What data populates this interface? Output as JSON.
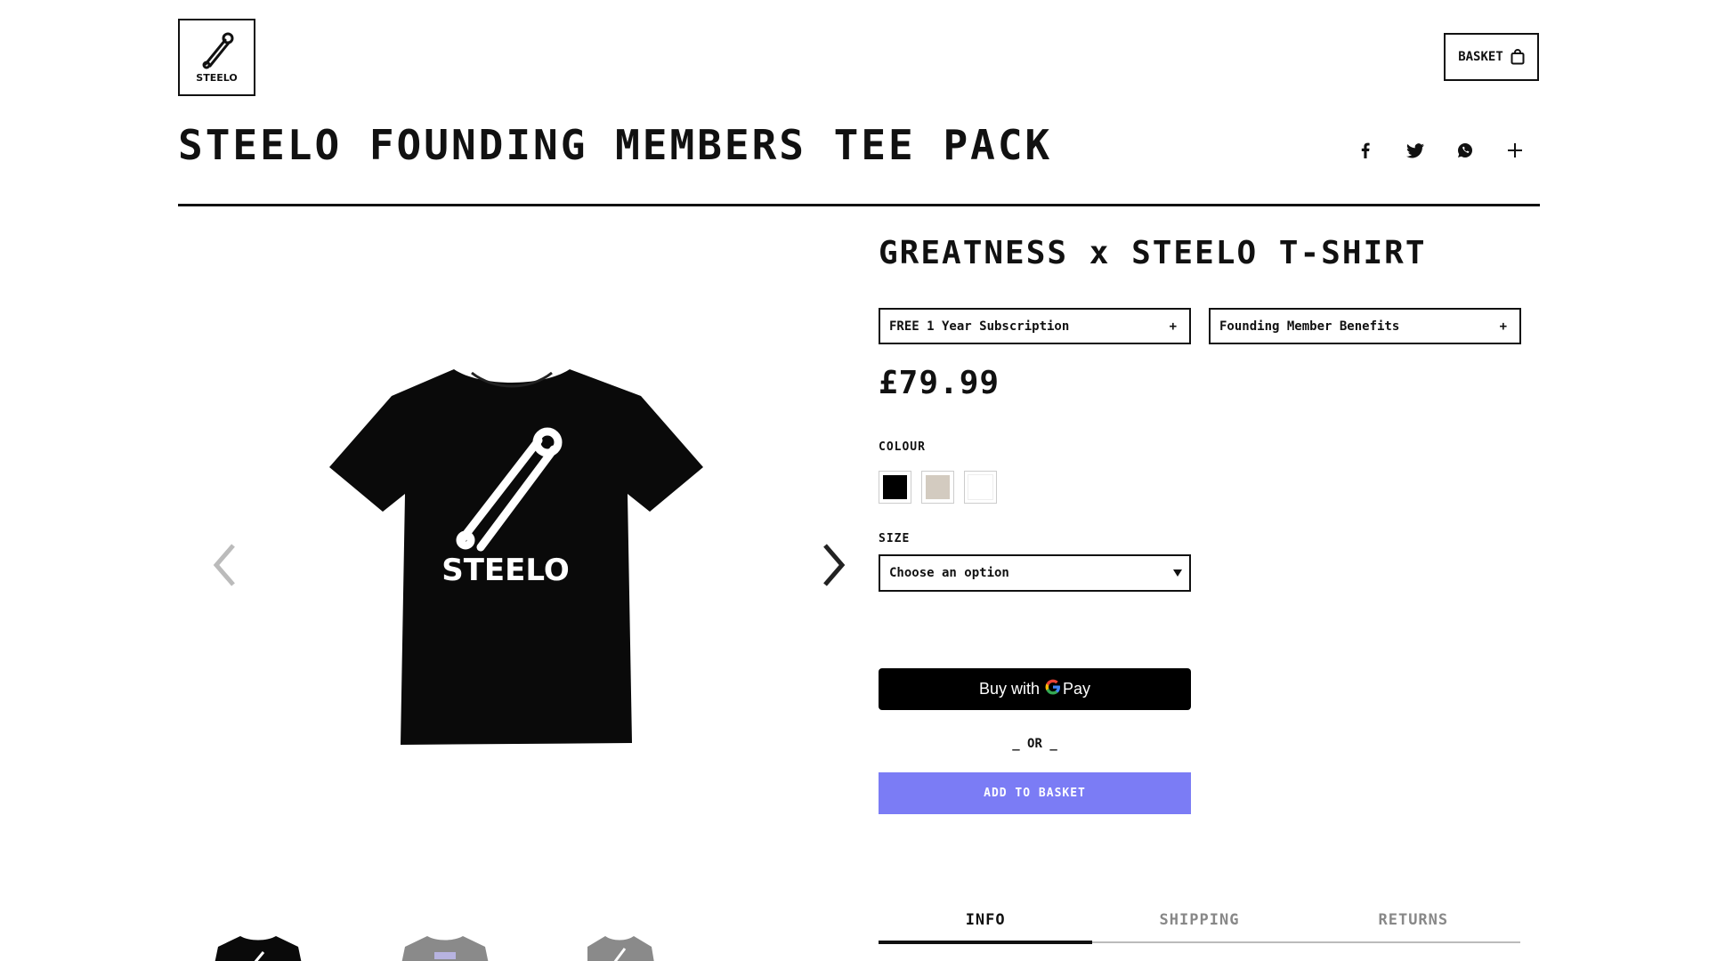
{
  "header": {
    "logo_text": "STEELO",
    "basket_label": "BASKET",
    "page_title": "STEELO FOUNDING MEMBERS TEE PACK"
  },
  "share_icons": [
    "facebook-icon",
    "twitter-icon",
    "whatsapp-icon",
    "plus-icon"
  ],
  "gallery": {
    "shirt_print": "STEELO",
    "thumbnails": [
      "black-shirt",
      "grey-shirt",
      "grey-pin-shirt"
    ]
  },
  "product": {
    "title": "GREATNESS x STEELO T-SHIRT",
    "accordions": [
      {
        "label": "FREE 1 Year Subscription",
        "icon": "+"
      },
      {
        "label": "Founding Member Benefits",
        "icon": "+"
      }
    ],
    "price": "£79.99",
    "colour_label": "COLOUR",
    "colours": [
      "#000000",
      "#d3cbc0",
      "#ffffff"
    ],
    "size_label": "SIZE",
    "size_placeholder": "Choose an option",
    "gpay_text": "Buy with",
    "gpay_brand": "Pay",
    "or_text": "_ OR _",
    "add_to_basket": "ADD TO BASKET"
  },
  "tabs": [
    {
      "label": "INFO",
      "active": true
    },
    {
      "label": "SHIPPING",
      "active": false
    },
    {
      "label": "RETURNS",
      "active": false
    }
  ],
  "colors": {
    "accent": "#7b7cf5",
    "text": "#111111"
  }
}
